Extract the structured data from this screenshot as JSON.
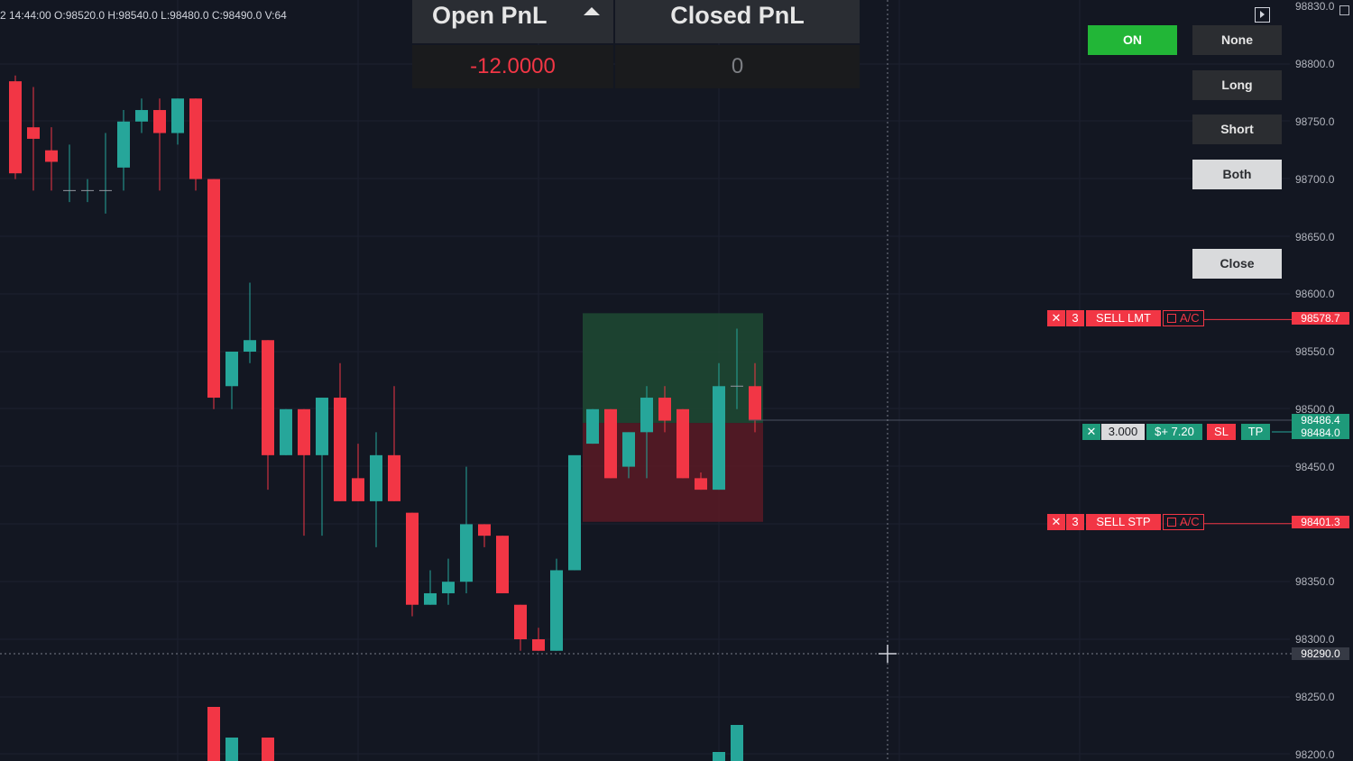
{
  "header": {
    "ohlc": "2 14:44:00 O:98520.0 H:98540.0 L:98480.0 C:98490.0 V:64"
  },
  "pnl_panel": {
    "open_label": "Open PnL",
    "closed_label": "Closed PnL",
    "open_value": "-12.0000",
    "closed_value": "0",
    "sort_icon": "caret-up-icon"
  },
  "controls": {
    "on_label": "ON",
    "none_label": "None",
    "long_label": "Long",
    "short_label": "Short",
    "both_label": "Both",
    "close_label": "Close"
  },
  "orders": {
    "sell_limit": {
      "close_icon": "x-icon",
      "qty": "3",
      "type": "SELL LMT",
      "ac": "A/C",
      "price": "98578.7"
    },
    "position": {
      "close_icon": "x-icon",
      "qty": "3.000",
      "pnl": "$+ 7.20",
      "sl": "SL",
      "tp": "TP",
      "price1": "98486.4",
      "price2": "98484.0"
    },
    "sell_stop": {
      "close_icon": "x-icon",
      "qty": "3",
      "type": "SELL STP",
      "ac": "A/C",
      "price": "98401.3"
    }
  },
  "crosshair": {
    "price": "98290.0"
  },
  "axis": {
    "labels": [
      "98830.0",
      "98800.0",
      "98750.0",
      "98700.0",
      "98650.0",
      "98600.0",
      "98550.0",
      "98500.0",
      "98450.0",
      "98350.0",
      "98300.0",
      "98250.0",
      "98200.0"
    ]
  },
  "colors": {
    "up": "#26a69a",
    "down": "#f23645",
    "background": "#131722",
    "on": "#22b637"
  },
  "chart_data": {
    "type": "candlestick",
    "y_range": [
      98200,
      98830
    ],
    "candles": [
      {
        "o": 98785,
        "h": 98790,
        "l": 98700,
        "c": 98705
      },
      {
        "o": 98745,
        "h": 98780,
        "l": 98690,
        "c": 98735
      },
      {
        "o": 98725,
        "h": 98745,
        "l": 98690,
        "c": 98715
      },
      {
        "o": 98690,
        "h": 98730,
        "l": 98680,
        "c": 98690
      },
      {
        "o": 98690,
        "h": 98700,
        "l": 98680,
        "c": 98690
      },
      {
        "o": 98690,
        "h": 98740,
        "l": 98670,
        "c": 98690
      },
      {
        "o": 98710,
        "h": 98760,
        "l": 98690,
        "c": 98750
      },
      {
        "o": 98750,
        "h": 98770,
        "l": 98740,
        "c": 98760
      },
      {
        "o": 98760,
        "h": 98770,
        "l": 98690,
        "c": 98740
      },
      {
        "o": 98740,
        "h": 98770,
        "l": 98730,
        "c": 98770
      },
      {
        "o": 98770,
        "h": 98770,
        "l": 98690,
        "c": 98700
      },
      {
        "o": 98700,
        "h": 98700,
        "l": 98500,
        "c": 98510
      },
      {
        "o": 98520,
        "h": 98550,
        "l": 98500,
        "c": 98550
      },
      {
        "o": 98550,
        "h": 98610,
        "l": 98540,
        "c": 98560
      },
      {
        "o": 98560,
        "h": 98560,
        "l": 98430,
        "c": 98460
      },
      {
        "o": 98460,
        "h": 98500,
        "l": 98460,
        "c": 98500
      },
      {
        "o": 98500,
        "h": 98500,
        "l": 98390,
        "c": 98460
      },
      {
        "o": 98460,
        "h": 98510,
        "l": 98390,
        "c": 98510
      },
      {
        "o": 98510,
        "h": 98540,
        "l": 98420,
        "c": 98420
      },
      {
        "o": 98440,
        "h": 98470,
        "l": 98420,
        "c": 98420
      },
      {
        "o": 98420,
        "h": 98480,
        "l": 98380,
        "c": 98460
      },
      {
        "o": 98460,
        "h": 98520,
        "l": 98420,
        "c": 98420
      },
      {
        "o": 98410,
        "h": 98410,
        "l": 98320,
        "c": 98330
      },
      {
        "o": 98330,
        "h": 98360,
        "l": 98330,
        "c": 98340
      },
      {
        "o": 98340,
        "h": 98370,
        "l": 98330,
        "c": 98350
      },
      {
        "o": 98350,
        "h": 98450,
        "l": 98340,
        "c": 98400
      },
      {
        "o": 98400,
        "h": 98400,
        "l": 98380,
        "c": 98390
      },
      {
        "o": 98390,
        "h": 98390,
        "l": 98340,
        "c": 98340
      },
      {
        "o": 98330,
        "h": 98330,
        "l": 98290,
        "c": 98300
      },
      {
        "o": 98300,
        "h": 98310,
        "l": 98290,
        "c": 98290
      },
      {
        "o": 98290,
        "h": 98370,
        "l": 98290,
        "c": 98360
      },
      {
        "o": 98360,
        "h": 98430,
        "l": 98360,
        "c": 98460
      },
      {
        "o": 98470,
        "h": 98500,
        "l": 98470,
        "c": 98500
      },
      {
        "o": 98500,
        "h": 98500,
        "l": 98440,
        "c": 98440
      },
      {
        "o": 98450,
        "h": 98480,
        "l": 98440,
        "c": 98480
      },
      {
        "o": 98480,
        "h": 98520,
        "l": 98440,
        "c": 98510
      },
      {
        "o": 98510,
        "h": 98520,
        "l": 98480,
        "c": 98490
      },
      {
        "o": 98500,
        "h": 98500,
        "l": 98440,
        "c": 98440
      },
      {
        "o": 98440,
        "h": 98445,
        "l": 98430,
        "c": 98430
      },
      {
        "o": 98430,
        "h": 98540,
        "l": 98430,
        "c": 98520
      },
      {
        "o": 98520,
        "h": 98570,
        "l": 98500,
        "c": 98520
      },
      {
        "o": 98520,
        "h": 98540,
        "l": 98480,
        "c": 98490
      }
    ],
    "position_box": {
      "entry": 98488,
      "take_profit": 98578.7,
      "stop_loss": 98401.3
    },
    "volume_bars": [
      {
        "index": 11,
        "dir": "down",
        "v": 60
      },
      {
        "index": 12,
        "dir": "up",
        "v": 26
      },
      {
        "index": 14,
        "dir": "down",
        "v": 26
      },
      {
        "index": 39,
        "dir": "up",
        "v": 10
      },
      {
        "index": 40,
        "dir": "up",
        "v": 40
      }
    ]
  }
}
